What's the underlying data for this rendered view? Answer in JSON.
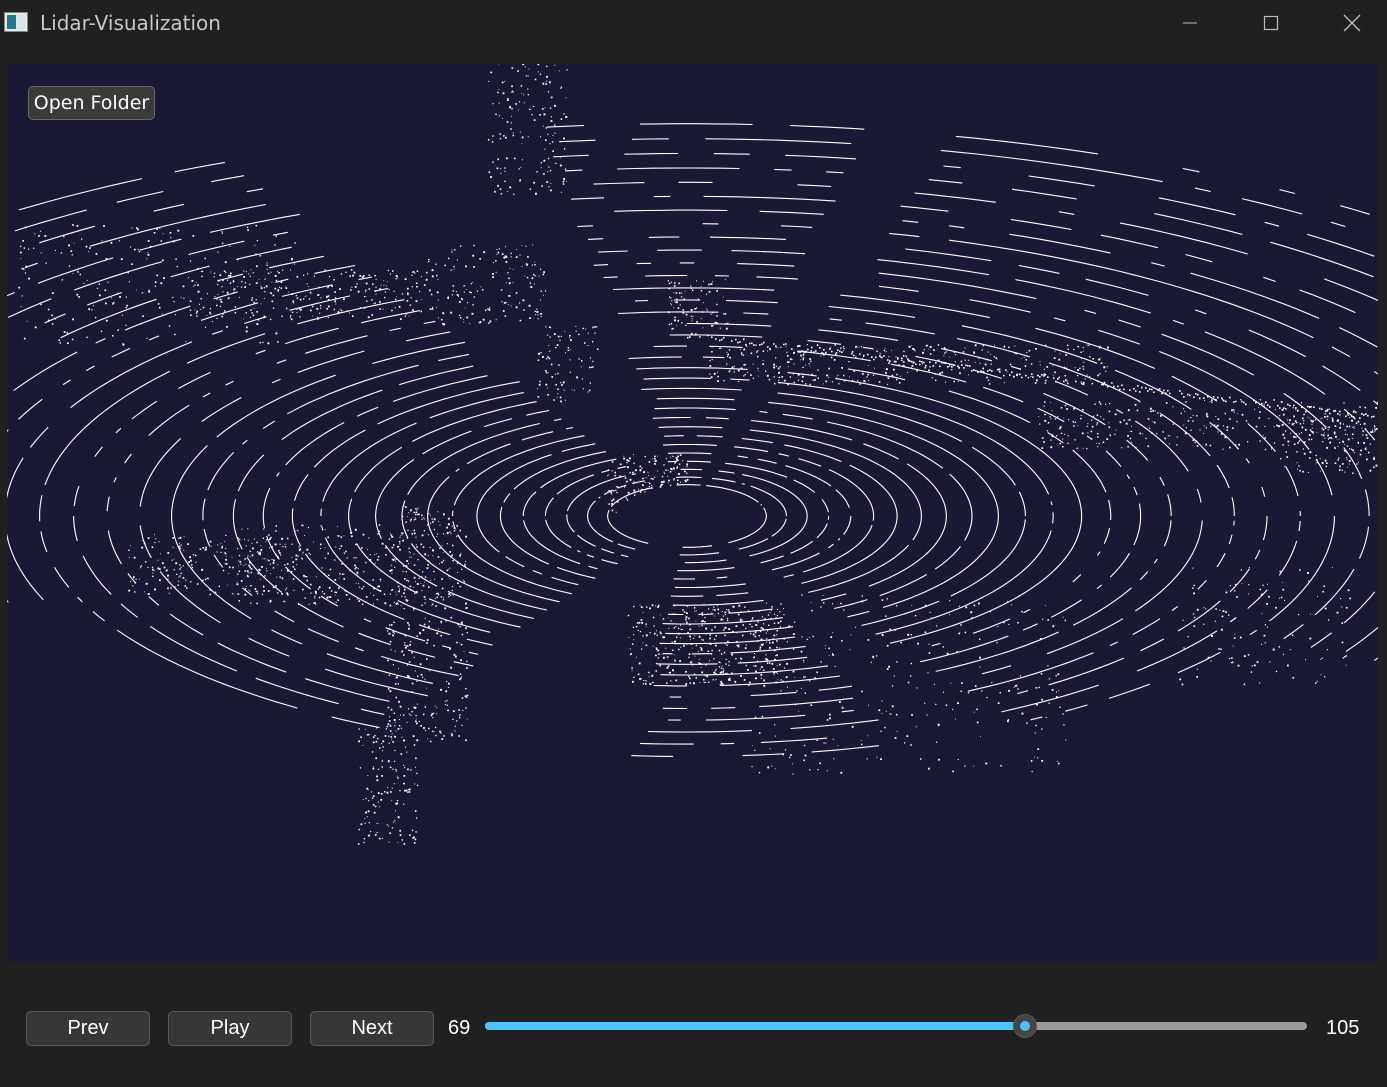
{
  "window": {
    "title": "Lidar-Visualization",
    "icons": [
      "app-icon",
      "minimize-icon",
      "maximize-icon",
      "close-icon"
    ]
  },
  "viewer": {
    "open_folder_label": "Open Folder",
    "background_color": "#191936",
    "point_color": "#ffffff"
  },
  "controls": {
    "prev_label": "Prev",
    "play_label": "Play",
    "next_label": "Next",
    "current_frame": "69",
    "total_frames": "105",
    "accent_color": "#4cc2ff"
  }
}
